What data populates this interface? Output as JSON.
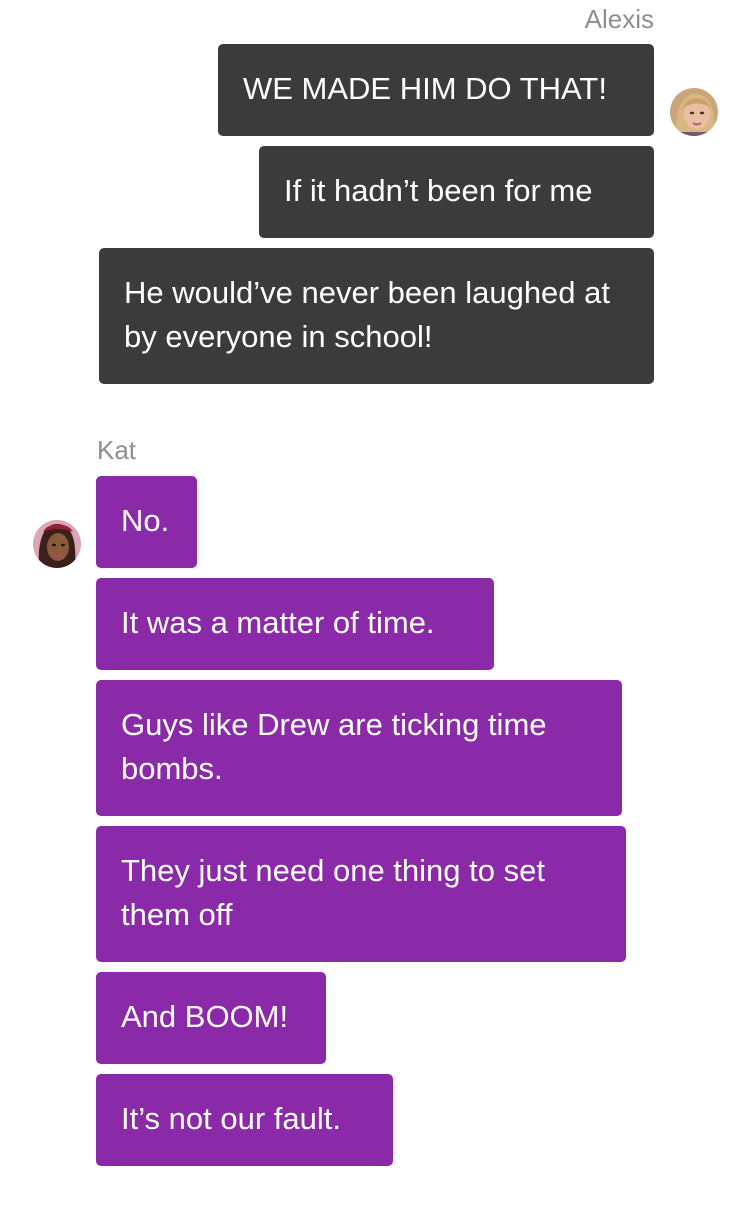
{
  "conversation": [
    {
      "sender": "Alexis",
      "side": "right",
      "bubble_color": "#3b3b3b",
      "avatar_icon": "alexis-avatar-icon",
      "messages": [
        "WE MADE HIM DO THAT!",
        "If it hadn’t been for me",
        "He would’ve never been laughed at by everyone in school!"
      ]
    },
    {
      "sender": "Kat",
      "side": "left",
      "bubble_color": "#8a2aa8",
      "avatar_icon": "kat-avatar-icon",
      "messages": [
        "No.",
        "It was a matter of time.",
        "Guys like Drew are ticking time bombs.",
        "They just need one thing to set them off",
        "And BOOM!",
        "It’s not our fault."
      ]
    }
  ]
}
